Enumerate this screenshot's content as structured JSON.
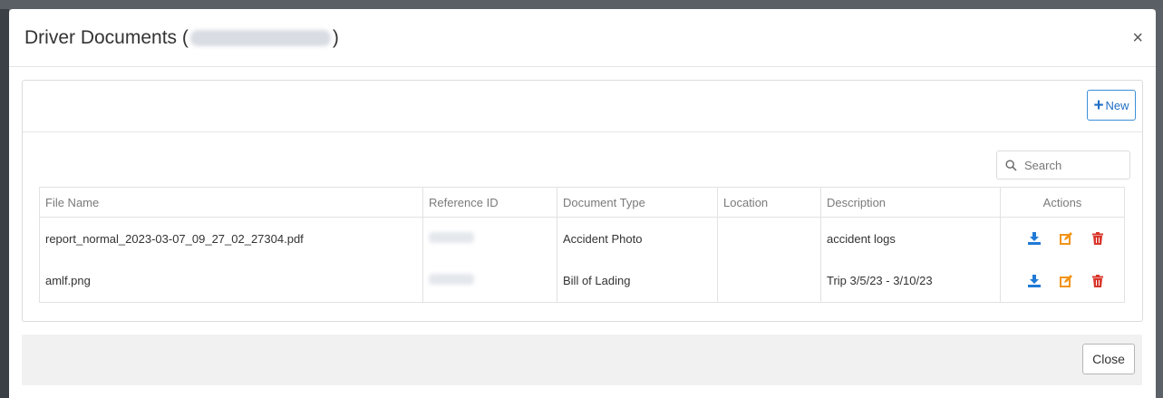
{
  "modal": {
    "title_prefix": "Driver Documents (",
    "title_suffix": ")",
    "close_symbol": "×"
  },
  "toolbar": {
    "new_label": "New",
    "new_icon": "plus-icon"
  },
  "search": {
    "placeholder": "Search",
    "icon": "search-icon"
  },
  "table": {
    "columns": [
      "File Name",
      "Reference ID",
      "Document Type",
      "Location",
      "Description",
      "Actions"
    ],
    "rows": [
      {
        "file_name": "report_normal_2023-03-07_09_27_02_27304.pdf",
        "document_type": "Accident Photo",
        "location": "",
        "description": "accident logs"
      },
      {
        "file_name": "amlf.png",
        "document_type": "Bill of Lading",
        "location": "",
        "description": "Trip 3/5/23 - 3/10/23"
      }
    ],
    "action_icons": [
      "download-icon",
      "edit-icon",
      "trash-icon"
    ]
  },
  "footer": {
    "close_label": "Close"
  },
  "colors": {
    "download": "#1f7ad6",
    "edit": "#f29418",
    "delete": "#d9362b",
    "primary_border": "#3b8fd9"
  }
}
